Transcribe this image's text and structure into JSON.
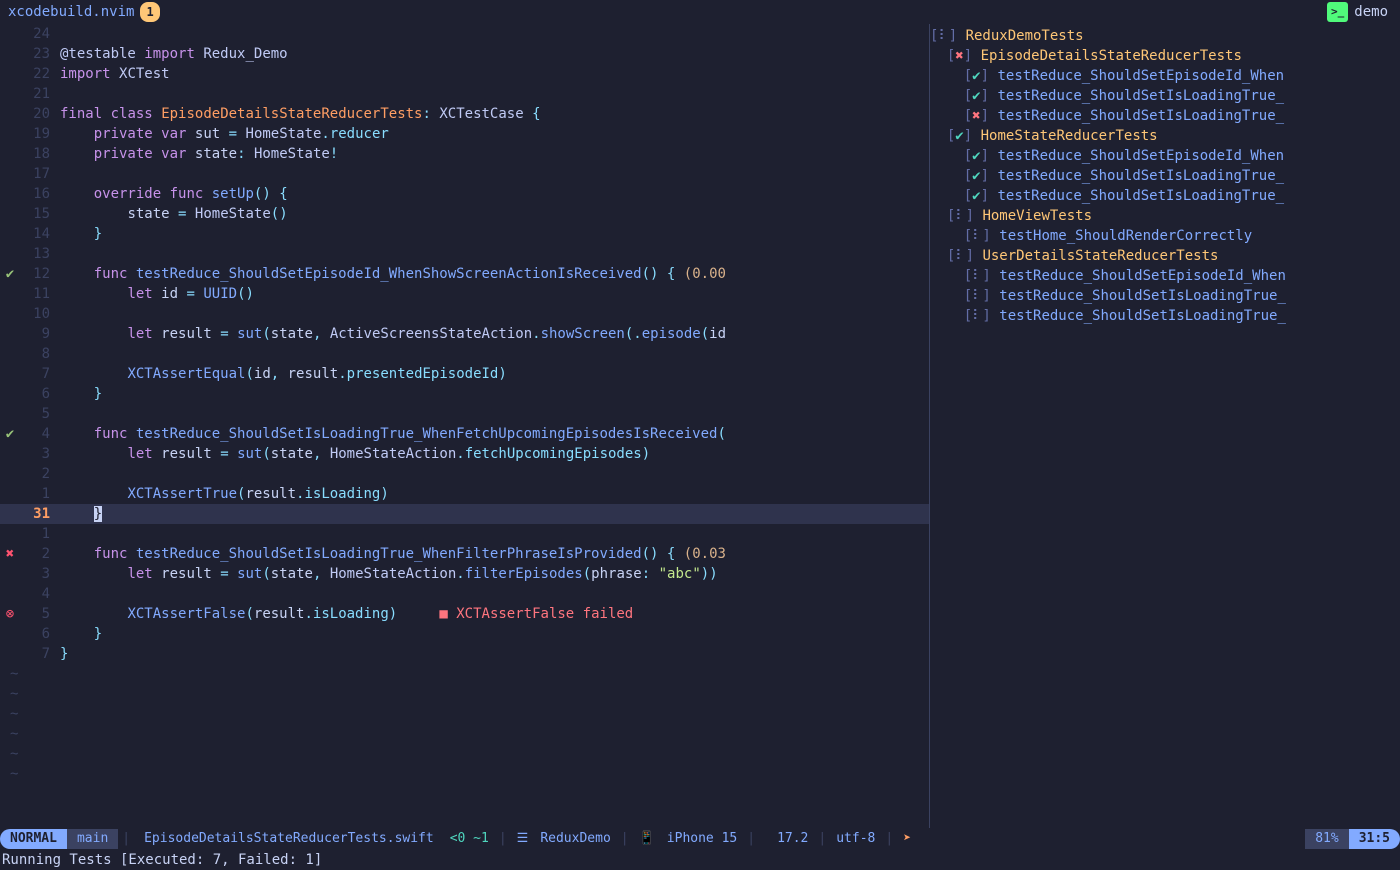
{
  "tabbar": {
    "title": "xcodebuild.nvim",
    "badge": "1",
    "right_icon": ">_",
    "right_label": "demo"
  },
  "editor": {
    "lines": [
      {
        "sign": "",
        "lnr": "24",
        "html": ""
      },
      {
        "sign": "",
        "lnr": "23",
        "html": "<span class='annot'>@testable</span> <span class='kw'>import</span> <span class='typ'>Redux_Demo</span>"
      },
      {
        "sign": "",
        "lnr": "22",
        "html": "<span class='kw'>import</span> <span class='typ'>XCTest</span>"
      },
      {
        "sign": "",
        "lnr": "21",
        "html": ""
      },
      {
        "sign": "",
        "lnr": "20",
        "html": "<span class='kw'>final</span> <span class='kw'>class</span> <span class='test-name'>EpisodeDetailsStateReducerTests</span><span class='pun'>:</span> <span class='typ'>XCTestCase</span> <span class='pun'>{</span>"
      },
      {
        "sign": "",
        "lnr": "19",
        "html": "    <span class='kw'>private</span> <span class='kw'>var</span> <span class='ident'>sut</span> <span class='pun'>=</span> <span class='typ'>HomeState</span><span class='pun'>.</span><span class='prop'>reducer</span>"
      },
      {
        "sign": "",
        "lnr": "18",
        "html": "    <span class='kw'>private</span> <span class='kw'>var</span> <span class='ident'>state</span><span class='pun'>:</span> <span class='typ'>HomeState</span><span class='pun'>!</span>"
      },
      {
        "sign": "",
        "lnr": "17",
        "html": ""
      },
      {
        "sign": "",
        "lnr": "16",
        "html": "    <span class='kw'>override</span> <span class='kw'>func</span> <span class='fn'>setUp</span><span class='pun'>()</span> <span class='pun'>{</span>"
      },
      {
        "sign": "",
        "lnr": "15",
        "html": "        <span class='ident'>state</span> <span class='pun'>=</span> <span class='typ'>HomeState</span><span class='pun'>()</span>"
      },
      {
        "sign": "",
        "lnr": "14",
        "html": "    <span class='pun'>}</span>"
      },
      {
        "sign": "",
        "lnr": "13",
        "html": ""
      },
      {
        "sign": "✔",
        "sigclass": "",
        "lnr": "12",
        "html": "    <span class='kw'>func</span> <span class='fn'>testReduce_ShouldSetEpisodeId_WhenShowScreenActionIsReceived</span><span class='pun'>()</span> <span class='pun'>{</span> <span class='time'>(0.00</span>"
      },
      {
        "sign": "",
        "lnr": "11",
        "html": "        <span class='kw'>let</span> <span class='ident'>id</span> <span class='pun'>=</span> <span class='call'>UUID</span><span class='pun'>()</span>"
      },
      {
        "sign": "",
        "lnr": "10",
        "html": ""
      },
      {
        "sign": "",
        "lnr": "9",
        "html": "        <span class='kw'>let</span> <span class='ident'>result</span> <span class='pun'>=</span> <span class='call'>sut</span><span class='pun'>(</span><span class='ident'>state</span><span class='pun'>,</span> <span class='typ'>ActiveScreensStateAction</span><span class='pun'>.</span><span class='call'>showScreen</span><span class='pun'>(.</span><span class='call'>episode</span><span class='pun'>(</span><span class='ident'>id</span>"
      },
      {
        "sign": "",
        "lnr": "8",
        "html": ""
      },
      {
        "sign": "",
        "lnr": "7",
        "html": "        <span class='call'>XCTAssertEqual</span><span class='pun'>(</span><span class='ident'>id</span><span class='pun'>,</span> <span class='ident'>result</span><span class='pun'>.</span><span class='prop'>presentedEpisodeId</span><span class='pun'>)</span>"
      },
      {
        "sign": "",
        "lnr": "6",
        "html": "    <span class='pun'>}</span>"
      },
      {
        "sign": "",
        "lnr": "5",
        "html": ""
      },
      {
        "sign": "✔",
        "sigclass": "",
        "lnr": "4",
        "html": "    <span class='kw'>func</span> <span class='fn'>testReduce_ShouldSetIsLoadingTrue_WhenFetchUpcomingEpisodesIsReceived</span><span class='pun'>(</span>"
      },
      {
        "sign": "",
        "lnr": "3",
        "html": "        <span class='kw'>let</span> <span class='ident'>result</span> <span class='pun'>=</span> <span class='call'>sut</span><span class='pun'>(</span><span class='ident'>state</span><span class='pun'>,</span> <span class='typ'>HomeStateAction</span><span class='pun'>.</span><span class='prop'>fetchUpcomingEpisodes</span><span class='pun'>)</span>"
      },
      {
        "sign": "",
        "lnr": "2",
        "html": ""
      },
      {
        "sign": "",
        "lnr": "1",
        "html": "        <span class='call'>XCTAssertTrue</span><span class='pun'>(</span><span class='ident'>result</span><span class='pun'>.</span><span class='prop'>isLoading</span><span class='pun'>)</span>"
      },
      {
        "sign": "",
        "lnr": "31",
        "cur": true,
        "html": "    <span class='cursor-brace'>}</span>"
      },
      {
        "sign": "",
        "lnr": "1",
        "html": ""
      },
      {
        "sign": "✖",
        "sigclass": "sign-err",
        "lnr": "2",
        "html": "    <span class='kw'>func</span> <span class='fn'>testReduce_ShouldSetIsLoadingTrue_WhenFilterPhraseIsProvided</span><span class='pun'>()</span> <span class='pun'>{</span> <span class='time'>(0.03</span>"
      },
      {
        "sign": "",
        "lnr": "3",
        "html": "        <span class='kw'>let</span> <span class='ident'>result</span> <span class='pun'>=</span> <span class='call'>sut</span><span class='pun'>(</span><span class='ident'>state</span><span class='pun'>,</span> <span class='typ'>HomeStateAction</span><span class='pun'>.</span><span class='call'>filterEpisodes</span><span class='pun'>(</span><span class='ident'>phrase</span><span class='pun'>:</span> <span class='str'>\"abc\"</span><span class='pun'>))</span>"
      },
      {
        "sign": "",
        "lnr": "4",
        "html": ""
      },
      {
        "sign": "⊗",
        "sigclass": "sign-diag",
        "lnr": "5",
        "html": "        <span class='call'>XCTAssertFalse</span><span class='pun'>(</span><span class='ident'>result</span><span class='pun'>.</span><span class='prop'>isLoading</span><span class='pun'>)</span>     <span class='err-box'>■</span> <span class='err-inline'>XCTAssertFalse failed</span>"
      },
      {
        "sign": "",
        "lnr": "6",
        "html": "    <span class='pun'>}</span>"
      },
      {
        "sign": "",
        "lnr": "7",
        "html": "<span class='pun'>}</span>"
      }
    ],
    "tildes": 6
  },
  "tests": [
    {
      "ind": 0,
      "icon": "⠇",
      "ic": "tr-icon",
      "text": "ReduxDemoTests",
      "cls": "tr-suite"
    },
    {
      "ind": 1,
      "icon": "✖",
      "ic": "tr-fail",
      "text": "EpisodeDetailsStateReducerTests",
      "cls": "tr-suite"
    },
    {
      "ind": 2,
      "icon": "✔",
      "ic": "tr-pass",
      "text": "testReduce_ShouldSetEpisodeId_When",
      "cls": "tr-test"
    },
    {
      "ind": 2,
      "icon": "✔",
      "ic": "tr-pass",
      "text": "testReduce_ShouldSetIsLoadingTrue_",
      "cls": "tr-test"
    },
    {
      "ind": 2,
      "icon": "✖",
      "ic": "tr-fail",
      "text": "testReduce_ShouldSetIsLoadingTrue_",
      "cls": "tr-test"
    },
    {
      "ind": 1,
      "icon": "✔",
      "ic": "tr-pass",
      "text": "HomeStateReducerTests",
      "cls": "tr-suite"
    },
    {
      "ind": 2,
      "icon": "✔",
      "ic": "tr-pass",
      "text": "testReduce_ShouldSetEpisodeId_When",
      "cls": "tr-test"
    },
    {
      "ind": 2,
      "icon": "✔",
      "ic": "tr-pass",
      "text": "testReduce_ShouldSetIsLoadingTrue_",
      "cls": "tr-test"
    },
    {
      "ind": 2,
      "icon": "✔",
      "ic": "tr-pass",
      "text": "testReduce_ShouldSetIsLoadingTrue_",
      "cls": "tr-test"
    },
    {
      "ind": 1,
      "icon": "⠇",
      "ic": "tr-icon",
      "text": "HomeViewTests",
      "cls": "tr-suite"
    },
    {
      "ind": 2,
      "icon": "⠇",
      "ic": "tr-icon",
      "text": "testHome_ShouldRenderCorrectly",
      "cls": "tr-test"
    },
    {
      "ind": 1,
      "icon": "⠇",
      "ic": "tr-icon",
      "text": "UserDetailsStateReducerTests",
      "cls": "tr-suite"
    },
    {
      "ind": 2,
      "icon": "⠇",
      "ic": "tr-icon",
      "text": "testReduce_ShouldSetEpisodeId_When",
      "cls": "tr-test"
    },
    {
      "ind": 2,
      "icon": "⠇",
      "ic": "tr-icon",
      "text": "testReduce_ShouldSetIsLoadingTrue_",
      "cls": "tr-test"
    },
    {
      "ind": 2,
      "icon": "⠇",
      "ic": "tr-icon",
      "text": "testReduce_ShouldSetIsLoadingTrue_",
      "cls": "tr-test"
    }
  ],
  "status": {
    "mode": "NORMAL",
    "branch_icon": "",
    "branch": "main",
    "file": "EpisodeDetailsStateReducerTests.swift",
    "diag": "<0 ~1",
    "project_icon": "☰",
    "project": "ReduxDemo",
    "device_icon": "📱",
    "device": "iPhone 15",
    "os_icon": "",
    "os": "17.2",
    "enc": "utf-8",
    "ft_icon": "➤",
    "percent": "81%",
    "position": "31:5"
  },
  "cmdline": "Running Tests [Executed: 7, Failed: 1]"
}
